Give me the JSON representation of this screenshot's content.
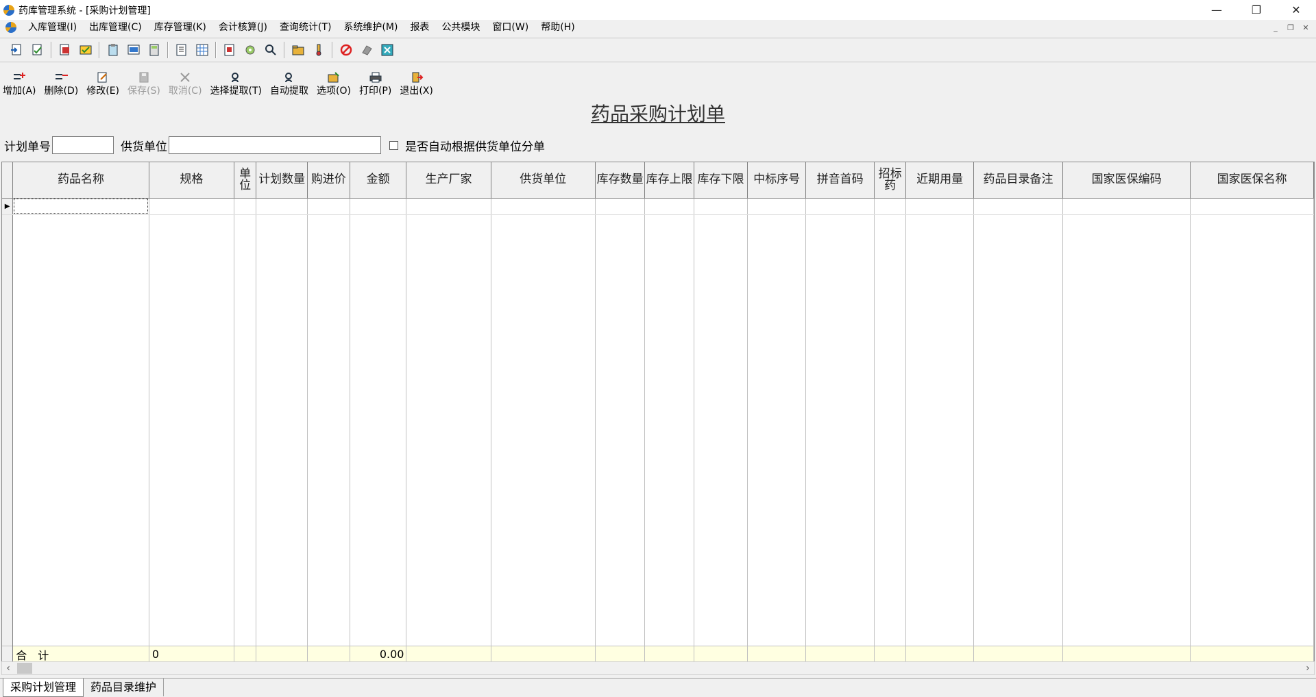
{
  "window": {
    "title": "药库管理系统 - [采购计划管理]",
    "controls": [
      "—",
      "❐",
      "✕"
    ]
  },
  "menu": {
    "items": [
      "入库管理(I)",
      "出库管理(C)",
      "库存管理(K)",
      "会计核算(J)",
      "查询统计(T)",
      "系统维护(M)",
      "报表",
      "公共模块",
      "窗口(W)",
      "帮助(H)"
    ],
    "mdi_controls": [
      "_",
      "❐",
      "✕"
    ]
  },
  "icon_toolbar": {
    "icons": [
      "import-icon",
      "check-import-icon",
      "export-icon",
      "approve-icon",
      "clipboard-icon",
      "list-icon",
      "calculator-icon",
      "report-icon",
      "table-icon",
      "plan-icon",
      "settings-icon",
      "search-icon",
      "folder-icon",
      "thermometer-icon",
      "stop-icon",
      "eraser-icon",
      "close-window-icon"
    ]
  },
  "actions": {
    "add": "增加(A)",
    "delete": "删除(D)",
    "modify": "修改(E)",
    "save": "保存(S)",
    "cancel": "取消(C)",
    "select_extract": "选择提取(T)",
    "auto_extract": "自动提取",
    "options": "选项(O)",
    "print": "打印(P)",
    "exit": "退出(X)"
  },
  "form": {
    "title": "药品采购计划单",
    "plan_no_label": "计划单号",
    "plan_no_value": "",
    "supplier_label": "供货单位",
    "supplier_value": "",
    "auto_split_label": "是否自动根据供货单位分单",
    "auto_split_checked": false
  },
  "grid": {
    "columns": [
      "药品名称",
      "规格",
      "单位",
      "计划数量",
      "购进价",
      "金额",
      "生产厂家",
      "供货单位",
      "库存数量",
      "库存上限",
      "库存下限",
      "中标序号",
      "拼音首码",
      "招标药",
      "近期用量",
      "药品目录备注",
      "国家医保编码",
      "国家医保名称"
    ],
    "total_label": "合　计",
    "total_quantity": "0",
    "total_amount": "0.00"
  },
  "bottom_tabs": [
    "采购计划管理",
    "药品目录维护"
  ]
}
